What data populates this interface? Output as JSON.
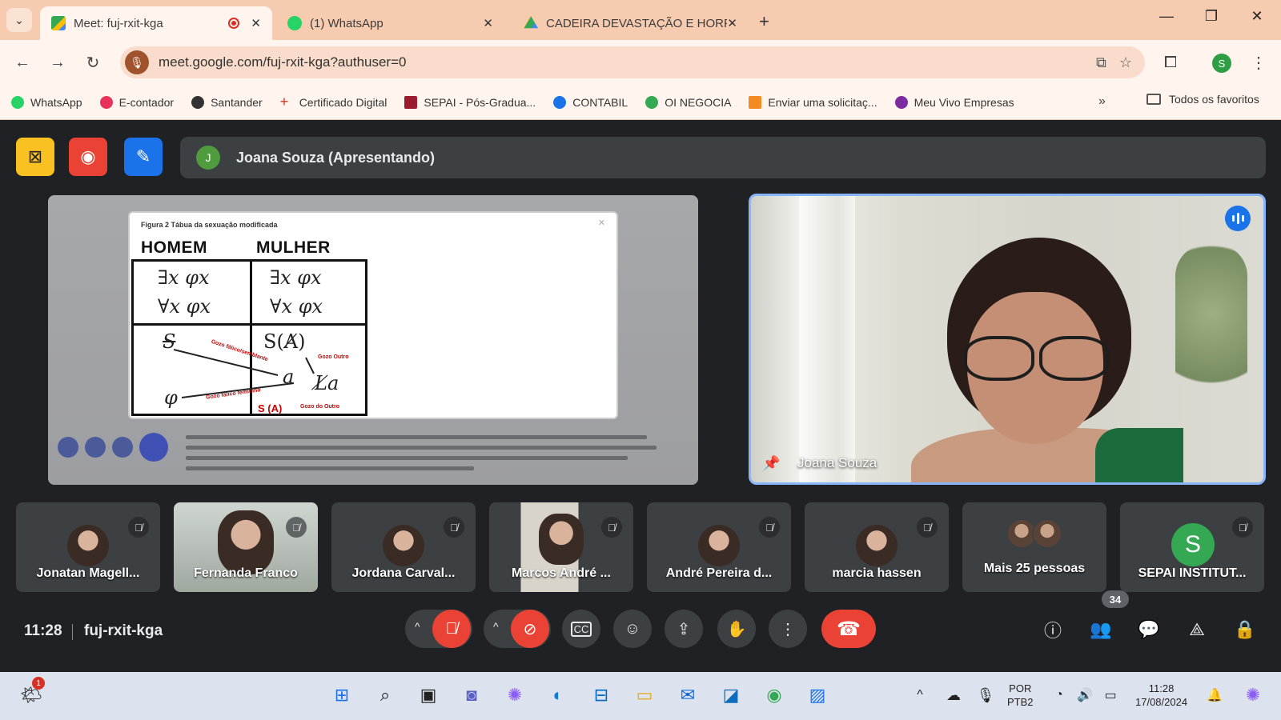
{
  "browser": {
    "tabs": [
      {
        "title": "Meet: fuj-rxit-kga",
        "active": true
      },
      {
        "title": "(1) WhatsApp",
        "active": false
      },
      {
        "title": "CADEIRA DEVASTAÇÃO E HORF",
        "active": false
      }
    ],
    "url": "meet.google.com/fuj-rxit-kga?authuser=0",
    "profile_initial": "S",
    "bookmarks": [
      {
        "label": "WhatsApp",
        "color": "#25d366"
      },
      {
        "label": "E-contador",
        "color": "#e8345c"
      },
      {
        "label": "Santander",
        "color": "#333333"
      },
      {
        "label": "Certificado Digital",
        "color": "#d93025"
      },
      {
        "label": "SEPAI - Pós-Gradua...",
        "color": "#9b1c2c"
      },
      {
        "label": "CONTABIL",
        "color": "#1a73e8"
      },
      {
        "label": "OI NEGOCIA",
        "color": "#34a853"
      },
      {
        "label": "Enviar uma solicitaç...",
        "color": "#f28b22"
      },
      {
        "label": "Meu Vivo Empresas",
        "color": "#7b2ca3"
      }
    ],
    "all_bookmarks_label": "Todos os favoritos"
  },
  "meet": {
    "presenter_initial": "J",
    "presenting_label": "Joana Souza (Apresentando)",
    "shared": {
      "figure_caption": "Figura 2 Tábua da sexuação modificada",
      "col_man": "HOMEM",
      "col_woman": "MULHER",
      "formula_man_1": "∃x φx",
      "formula_man_2": "∀x φx",
      "formula_woman_1": "∃x φx",
      "formula_woman_2": "∀x φx",
      "symbol_s_barred": "S",
      "symbol_s_a": "S(A̸)",
      "symbol_a": "a",
      "symbol_la": "L̸a",
      "symbol_phi": "φ",
      "symbol_s_a_red": "S (A)",
      "note_1": "Gozo fálico/semblante",
      "note_2": "Gozo Outro",
      "note_3": "Gozo fálico feminino",
      "note_4": "Gozo do Outro"
    },
    "speaker": {
      "name": "Joana Souza"
    },
    "participants": [
      {
        "name": "Jonatan Magell...",
        "muted": true
      },
      {
        "name": "Fernanda Franco",
        "muted": true
      },
      {
        "name": "Jordana Carval...",
        "muted": true
      },
      {
        "name": "Marcos André ...",
        "muted": true
      },
      {
        "name": "André Pereira d...",
        "muted": true
      },
      {
        "name": "marcia hassen",
        "muted": true
      },
      {
        "name": "Mais 25 pessoas",
        "muted": false
      },
      {
        "name": "SEPAI INSTITUT...",
        "muted": true,
        "initial": "S"
      }
    ],
    "time": "11:28",
    "meeting_code": "fuj-rxit-kga",
    "people_count": "34"
  },
  "taskbar": {
    "notification_count": "1",
    "language_line1": "POR",
    "language_line2": "PTB2",
    "clock_time": "11:28",
    "clock_date": "17/08/2024"
  },
  "colors": {
    "accent_blue": "#8ab4f8",
    "danger_red": "#ea4335",
    "meet_bg": "#202124",
    "tile_bg": "#3c4043"
  }
}
